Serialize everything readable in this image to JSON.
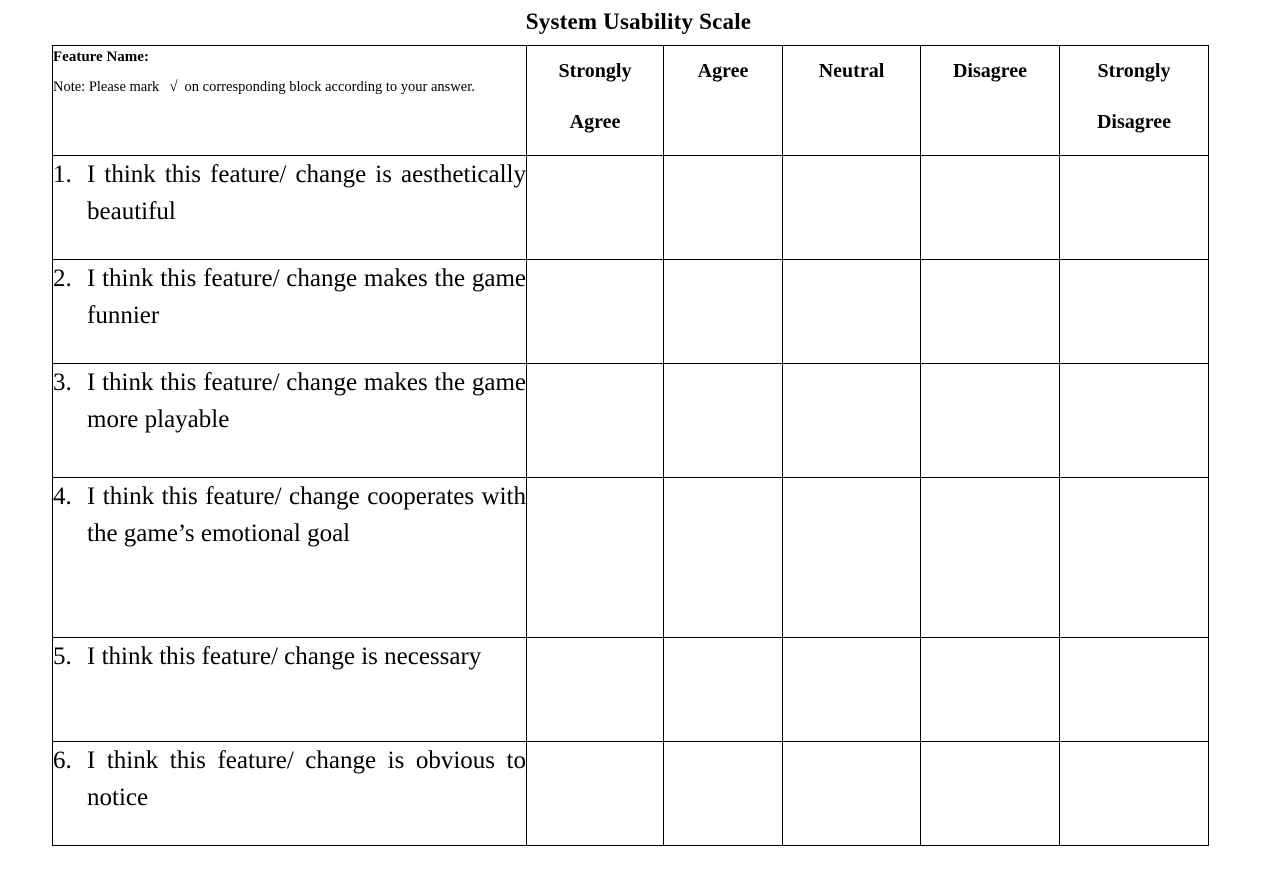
{
  "document": {
    "title": "System Usability Scale"
  },
  "table": {
    "header": {
      "feature_name_label": "Feature Name:",
      "note_prefix": "Note: Please mark",
      "note_tick_symbol": "√",
      "note_suffix": "on corresponding block according to your answer.",
      "scale_columns": [
        {
          "line1": "Strongly",
          "line2": "Agree"
        },
        {
          "line1": "Agree",
          "line2": ""
        },
        {
          "line1": "Neutral",
          "line2": ""
        },
        {
          "line1": "Disagree",
          "line2": ""
        },
        {
          "line1": "Strongly",
          "line2": "Disagree"
        }
      ]
    },
    "statements": [
      {
        "number": "1.",
        "text": "I think this feature/ change is aesthetically beautiful"
      },
      {
        "number": "2.",
        "text": "I think this feature/ change makes the game funnier"
      },
      {
        "number": "3.",
        "text": "I think this feature/ change makes the game more playable"
      },
      {
        "number": "4.",
        "text": "I think this feature/ change cooperates with the game’s emotional goal"
      },
      {
        "number": "5.",
        "text": "I think this feature/ change is necessary"
      },
      {
        "number": "6.",
        "text": "I think this feature/ change is obvious to notice"
      }
    ]
  },
  "style": {
    "border_color": "#000000",
    "background_color": "#ffffff",
    "text_color": "#000000"
  }
}
